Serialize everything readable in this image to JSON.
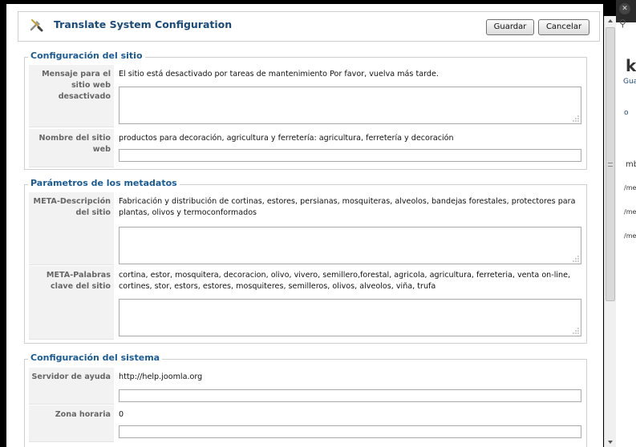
{
  "dialog": {
    "title": "Translate System Configuration",
    "save_label": "Guardar",
    "cancel_label": "Cancelar"
  },
  "sections": {
    "site": {
      "legend": "Configuración del sitio",
      "offline_message_label": "Mensaje para el sitio web desactivado",
      "offline_message_value": "El sitio está desactivado por tareas de mantenimiento Por favor, vuelva más tarde.",
      "site_name_label": "Nombre del sitio web",
      "site_name_value": "productos para decoración, agricultura y ferretería: agricultura, ferretería y decoración"
    },
    "metadata": {
      "legend": "Parámetros de los metadatos",
      "meta_desc_label": "META-Descripción del sitio",
      "meta_desc_value": "Fabricación y distribución de cortinas, estores, persianas, mosquiteras, alveolos, bandejas forestales, protectores para plantas, olivos y termoconformados",
      "meta_keys_label": "META-Palabras clave del sitio",
      "meta_keys_value": "cortina, estor, mosquitera, decoracion, olivo, vivero, semillero,forestal, agricola, agricultura, ferreteria, venta on-line, cortines, stor, estors, estores, mosquiteres, semilleros, olivos, alveolos, viña, trufa"
    },
    "system": {
      "legend": "Configuración del sistema",
      "help_server_label": "Servidor de ayuda",
      "help_server_value": "http://help.joomla.org",
      "timezone_label": "Zona horaria",
      "timezone_value": "0"
    }
  },
  "background_page": {
    "fragments": [
      "k",
      "Gua",
      "o",
      "mb",
      "/me",
      "/me",
      "/me"
    ]
  },
  "colors": {
    "title": "#1a4a7a",
    "legend": "#1a5a95",
    "label_bg": "#f2f2f2"
  }
}
